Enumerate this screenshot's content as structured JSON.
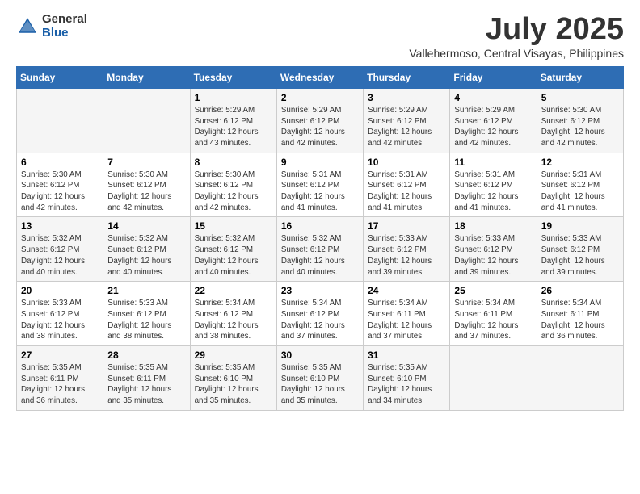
{
  "logo": {
    "general": "General",
    "blue": "Blue"
  },
  "header": {
    "title": "July 2025",
    "subtitle": "Vallehermoso, Central Visayas, Philippines"
  },
  "weekdays": [
    "Sunday",
    "Monday",
    "Tuesday",
    "Wednesday",
    "Thursday",
    "Friday",
    "Saturday"
  ],
  "weeks": [
    [
      {
        "day": "",
        "sunrise": "",
        "sunset": "",
        "daylight": ""
      },
      {
        "day": "",
        "sunrise": "",
        "sunset": "",
        "daylight": ""
      },
      {
        "day": "1",
        "sunrise": "Sunrise: 5:29 AM",
        "sunset": "Sunset: 6:12 PM",
        "daylight": "Daylight: 12 hours and 43 minutes."
      },
      {
        "day": "2",
        "sunrise": "Sunrise: 5:29 AM",
        "sunset": "Sunset: 6:12 PM",
        "daylight": "Daylight: 12 hours and 42 minutes."
      },
      {
        "day": "3",
        "sunrise": "Sunrise: 5:29 AM",
        "sunset": "Sunset: 6:12 PM",
        "daylight": "Daylight: 12 hours and 42 minutes."
      },
      {
        "day": "4",
        "sunrise": "Sunrise: 5:29 AM",
        "sunset": "Sunset: 6:12 PM",
        "daylight": "Daylight: 12 hours and 42 minutes."
      },
      {
        "day": "5",
        "sunrise": "Sunrise: 5:30 AM",
        "sunset": "Sunset: 6:12 PM",
        "daylight": "Daylight: 12 hours and 42 minutes."
      }
    ],
    [
      {
        "day": "6",
        "sunrise": "Sunrise: 5:30 AM",
        "sunset": "Sunset: 6:12 PM",
        "daylight": "Daylight: 12 hours and 42 minutes."
      },
      {
        "day": "7",
        "sunrise": "Sunrise: 5:30 AM",
        "sunset": "Sunset: 6:12 PM",
        "daylight": "Daylight: 12 hours and 42 minutes."
      },
      {
        "day": "8",
        "sunrise": "Sunrise: 5:30 AM",
        "sunset": "Sunset: 6:12 PM",
        "daylight": "Daylight: 12 hours and 42 minutes."
      },
      {
        "day": "9",
        "sunrise": "Sunrise: 5:31 AM",
        "sunset": "Sunset: 6:12 PM",
        "daylight": "Daylight: 12 hours and 41 minutes."
      },
      {
        "day": "10",
        "sunrise": "Sunrise: 5:31 AM",
        "sunset": "Sunset: 6:12 PM",
        "daylight": "Daylight: 12 hours and 41 minutes."
      },
      {
        "day": "11",
        "sunrise": "Sunrise: 5:31 AM",
        "sunset": "Sunset: 6:12 PM",
        "daylight": "Daylight: 12 hours and 41 minutes."
      },
      {
        "day": "12",
        "sunrise": "Sunrise: 5:31 AM",
        "sunset": "Sunset: 6:12 PM",
        "daylight": "Daylight: 12 hours and 41 minutes."
      }
    ],
    [
      {
        "day": "13",
        "sunrise": "Sunrise: 5:32 AM",
        "sunset": "Sunset: 6:12 PM",
        "daylight": "Daylight: 12 hours and 40 minutes."
      },
      {
        "day": "14",
        "sunrise": "Sunrise: 5:32 AM",
        "sunset": "Sunset: 6:12 PM",
        "daylight": "Daylight: 12 hours and 40 minutes."
      },
      {
        "day": "15",
        "sunrise": "Sunrise: 5:32 AM",
        "sunset": "Sunset: 6:12 PM",
        "daylight": "Daylight: 12 hours and 40 minutes."
      },
      {
        "day": "16",
        "sunrise": "Sunrise: 5:32 AM",
        "sunset": "Sunset: 6:12 PM",
        "daylight": "Daylight: 12 hours and 40 minutes."
      },
      {
        "day": "17",
        "sunrise": "Sunrise: 5:33 AM",
        "sunset": "Sunset: 6:12 PM",
        "daylight": "Daylight: 12 hours and 39 minutes."
      },
      {
        "day": "18",
        "sunrise": "Sunrise: 5:33 AM",
        "sunset": "Sunset: 6:12 PM",
        "daylight": "Daylight: 12 hours and 39 minutes."
      },
      {
        "day": "19",
        "sunrise": "Sunrise: 5:33 AM",
        "sunset": "Sunset: 6:12 PM",
        "daylight": "Daylight: 12 hours and 39 minutes."
      }
    ],
    [
      {
        "day": "20",
        "sunrise": "Sunrise: 5:33 AM",
        "sunset": "Sunset: 6:12 PM",
        "daylight": "Daylight: 12 hours and 38 minutes."
      },
      {
        "day": "21",
        "sunrise": "Sunrise: 5:33 AM",
        "sunset": "Sunset: 6:12 PM",
        "daylight": "Daylight: 12 hours and 38 minutes."
      },
      {
        "day": "22",
        "sunrise": "Sunrise: 5:34 AM",
        "sunset": "Sunset: 6:12 PM",
        "daylight": "Daylight: 12 hours and 38 minutes."
      },
      {
        "day": "23",
        "sunrise": "Sunrise: 5:34 AM",
        "sunset": "Sunset: 6:12 PM",
        "daylight": "Daylight: 12 hours and 37 minutes."
      },
      {
        "day": "24",
        "sunrise": "Sunrise: 5:34 AM",
        "sunset": "Sunset: 6:11 PM",
        "daylight": "Daylight: 12 hours and 37 minutes."
      },
      {
        "day": "25",
        "sunrise": "Sunrise: 5:34 AM",
        "sunset": "Sunset: 6:11 PM",
        "daylight": "Daylight: 12 hours and 37 minutes."
      },
      {
        "day": "26",
        "sunrise": "Sunrise: 5:34 AM",
        "sunset": "Sunset: 6:11 PM",
        "daylight": "Daylight: 12 hours and 36 minutes."
      }
    ],
    [
      {
        "day": "27",
        "sunrise": "Sunrise: 5:35 AM",
        "sunset": "Sunset: 6:11 PM",
        "daylight": "Daylight: 12 hours and 36 minutes."
      },
      {
        "day": "28",
        "sunrise": "Sunrise: 5:35 AM",
        "sunset": "Sunset: 6:11 PM",
        "daylight": "Daylight: 12 hours and 35 minutes."
      },
      {
        "day": "29",
        "sunrise": "Sunrise: 5:35 AM",
        "sunset": "Sunset: 6:10 PM",
        "daylight": "Daylight: 12 hours and 35 minutes."
      },
      {
        "day": "30",
        "sunrise": "Sunrise: 5:35 AM",
        "sunset": "Sunset: 6:10 PM",
        "daylight": "Daylight: 12 hours and 35 minutes."
      },
      {
        "day": "31",
        "sunrise": "Sunrise: 5:35 AM",
        "sunset": "Sunset: 6:10 PM",
        "daylight": "Daylight: 12 hours and 34 minutes."
      },
      {
        "day": "",
        "sunrise": "",
        "sunset": "",
        "daylight": ""
      },
      {
        "day": "",
        "sunrise": "",
        "sunset": "",
        "daylight": ""
      }
    ]
  ]
}
